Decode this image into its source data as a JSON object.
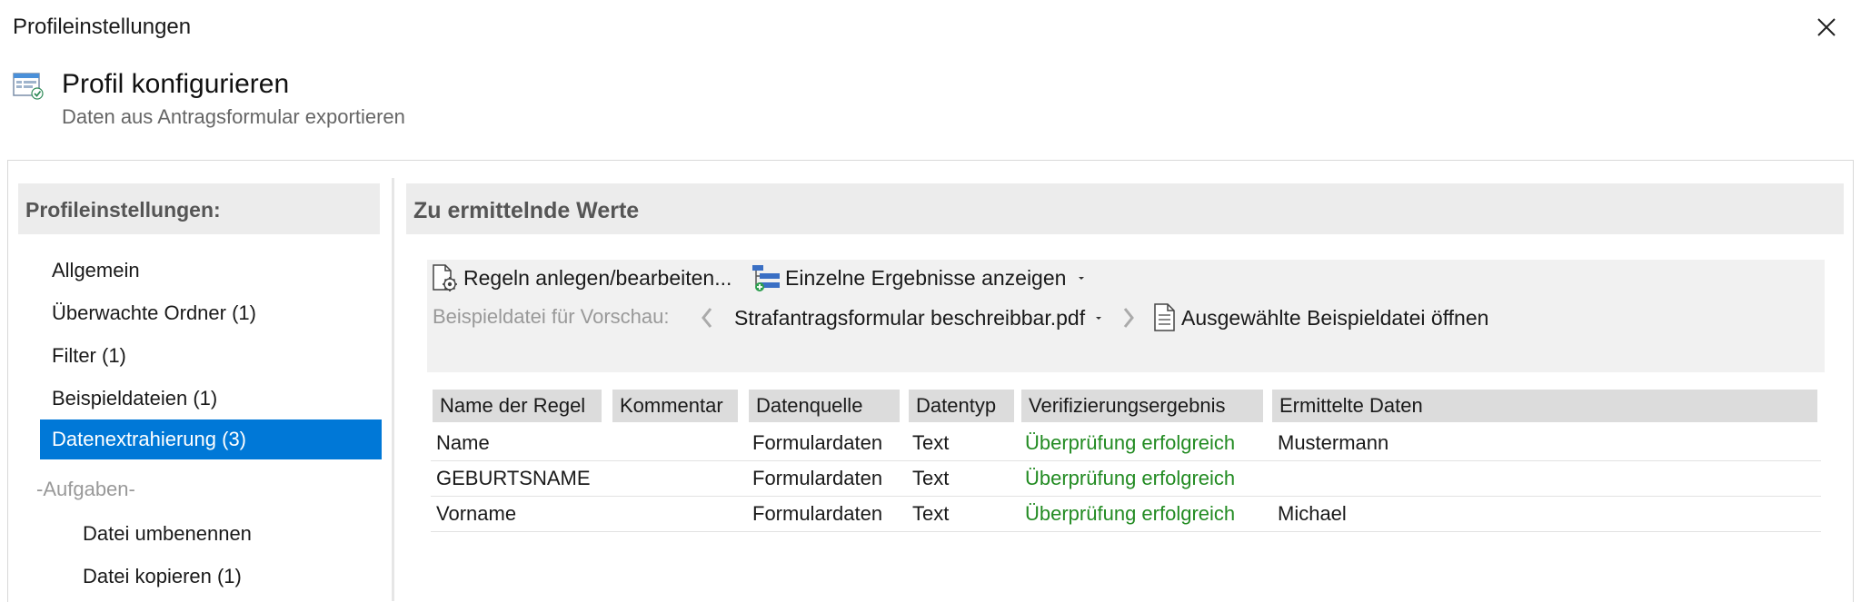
{
  "window": {
    "title": "Profileinstellungen"
  },
  "header": {
    "title": "Profil konfigurieren",
    "subtitle": "Daten aus Antragsformular exportieren"
  },
  "sidebar": {
    "heading": "Profileinstellungen:",
    "items": [
      {
        "label": "Allgemein"
      },
      {
        "label": "Überwachte Ordner (1)"
      },
      {
        "label": "Filter (1)"
      },
      {
        "label": "Beispieldateien (1)"
      },
      {
        "label": "Datenextrahierung (3)",
        "active": true
      }
    ],
    "group_label": "-Aufgaben-",
    "tasks": [
      {
        "label": "Datei umbenennen"
      },
      {
        "label": "Datei kopieren (1)"
      }
    ]
  },
  "main": {
    "heading": "Zu ermittelnde Werte",
    "toolbar": {
      "rules_button": "Regeln anlegen/bearbeiten...",
      "results_button": "Einzelne Ergebnisse anzeigen",
      "preview_label": "Beispieldatei für Vorschau:",
      "preview_file": "Strafantragsformular beschreibbar.pdf",
      "open_button": "Ausgewählte Beispieldatei öffnen"
    },
    "table": {
      "columns": [
        "Name der Regel",
        "Kommentar",
        "Datenquelle",
        "Datentyp",
        "Verifizierungsergebnis",
        "Ermittelte Daten"
      ],
      "rows": [
        {
          "name": "Name",
          "comment": "",
          "source": "Formulardaten",
          "type": "Text",
          "result": "Überprüfung erfolgreich",
          "data": "Mustermann"
        },
        {
          "name": "GEBURTSNAME",
          "comment": "",
          "source": "Formulardaten",
          "type": "Text",
          "result": "Überprüfung erfolgreich",
          "data": ""
        },
        {
          "name": "Vorname",
          "comment": "",
          "source": "Formulardaten",
          "type": "Text",
          "result": "Überprüfung erfolgreich",
          "data": "Michael"
        }
      ]
    }
  },
  "colors": {
    "accent": "#0078d7",
    "success": "#228b22",
    "section_bg": "#ececec",
    "muted": "#999999"
  }
}
